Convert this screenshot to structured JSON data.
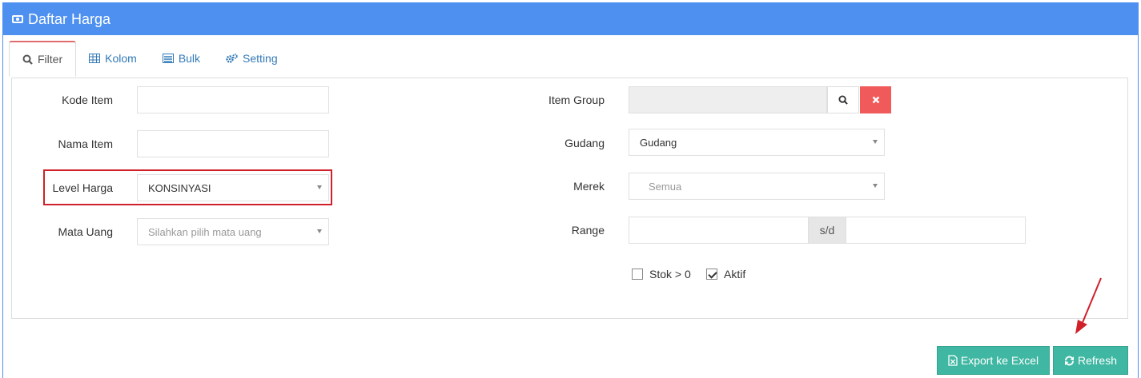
{
  "header": {
    "title": "Daftar Harga",
    "icon": "money-icon"
  },
  "tabs": [
    {
      "label": "Filter",
      "icon": "search-icon",
      "active": true
    },
    {
      "label": "Kolom",
      "icon": "table-icon",
      "active": false
    },
    {
      "label": "Bulk",
      "icon": "list-icon",
      "active": false
    },
    {
      "label": "Setting",
      "icon": "cogs-icon",
      "active": false
    }
  ],
  "filter": {
    "kode_item": {
      "label": "Kode Item",
      "value": ""
    },
    "nama_item": {
      "label": "Nama Item",
      "value": ""
    },
    "level_harga": {
      "label": "Level Harga",
      "value": "KONSINYASI"
    },
    "mata_uang": {
      "label": "Mata Uang",
      "placeholder": "Silahkan pilih mata uang"
    },
    "item_group": {
      "label": "Item Group",
      "value": ""
    },
    "gudang": {
      "label": "Gudang",
      "value": "Gudang"
    },
    "merek": {
      "label": "Merek",
      "placeholder": "Semua"
    },
    "range": {
      "label": "Range",
      "separator": "s/d",
      "from": "",
      "to": ""
    },
    "stok": {
      "label": "Stok > 0",
      "checked": false
    },
    "aktif": {
      "label": "Aktif",
      "checked": true
    }
  },
  "actions": {
    "export_label": "Export ke Excel",
    "refresh_label": "Refresh"
  },
  "colors": {
    "header": "#4d90f0",
    "button": "#3fb7a2",
    "clear": "#f05a5a",
    "highlight": "#d0202a"
  }
}
